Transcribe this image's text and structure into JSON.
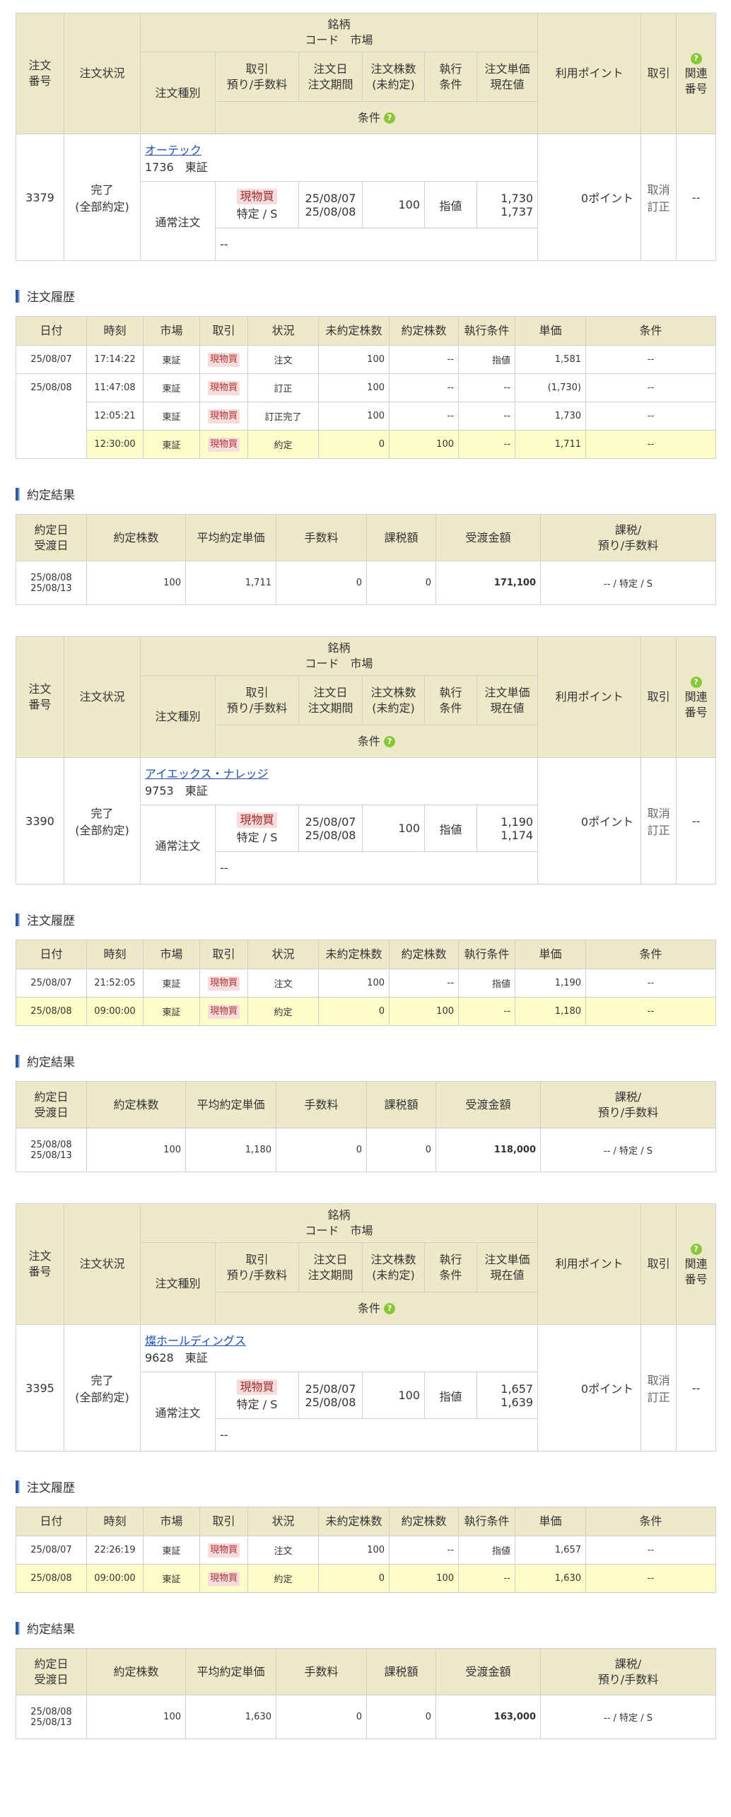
{
  "order_header": {
    "meigara": "銘柄",
    "code_market": "コード　市場",
    "order_no": "注文\n番号",
    "status": "注文状況",
    "order_type": "注文種別",
    "torihiki": "取引\n預り/手数料",
    "order_date": "注文日\n注文期間",
    "qty": "注文株数\n(未約定)",
    "exec_cond": "執行\n条件",
    "price": "注文単価\n現在値",
    "points": "利用ポイント",
    "trade": "取引",
    "related": "関連\n番号",
    "conditions": "条件"
  },
  "section_labels": {
    "history": "注文履歴",
    "result": "約定結果"
  },
  "history_header": [
    "日付",
    "時刻",
    "市場",
    "取引",
    "状況",
    "未約定株数",
    "約定株数",
    "執行条件",
    "単価",
    "条件"
  ],
  "result_header": [
    "約定日\n受渡日",
    "約定株数",
    "平均約定単価",
    "手数料",
    "課税額",
    "受渡金額",
    "課税/\n預り/手数料"
  ],
  "orders": [
    {
      "no": "3379",
      "status": "完了\n(全部約定)",
      "name": "オーテック",
      "code_market": "1736　東証",
      "order_type": "通常注文",
      "badge": "現物買",
      "account": "特定 / S",
      "date": "25/08/07\n25/08/08",
      "qty": "100",
      "exec": "指値",
      "price": "1,730\n1,737",
      "points": "0ポイント",
      "actions": "取消\n訂正",
      "related": "--",
      "condition": "--",
      "history": [
        {
          "date": "25/08/07",
          "time": "17:14:22",
          "market": "東証",
          "trade": "現物買",
          "status": "注文",
          "unfilled": "100",
          "filled": "--",
          "exec": "指値",
          "price": "1,581",
          "cond": "--",
          "hl": false
        },
        {
          "date": "25/08/08",
          "time": "11:47:08",
          "market": "東証",
          "trade": "現物買",
          "status": "訂正",
          "unfilled": "100",
          "filled": "--",
          "exec": "--",
          "price": "(1,730)",
          "cond": "--",
          "hl": false
        },
        {
          "date": "",
          "time": "12:05:21",
          "market": "東証",
          "trade": "現物買",
          "status": "訂正完了",
          "unfilled": "100",
          "filled": "--",
          "exec": "--",
          "price": "1,730",
          "cond": "--",
          "hl": false
        },
        {
          "date": "",
          "time": "12:30:00",
          "market": "東証",
          "trade": "現物買",
          "status": "約定",
          "unfilled": "0",
          "filled": "100",
          "exec": "--",
          "price": "1,711",
          "cond": "--",
          "hl": true
        }
      ],
      "result": {
        "dates": "25/08/08\n25/08/13",
        "qty": "100",
        "avg": "1,711",
        "fee": "0",
        "tax": "0",
        "amount": "171,100",
        "acct": "-- / 特定 / S"
      }
    },
    {
      "no": "3390",
      "status": "完了\n(全部約定)",
      "name": "アイエックス・ナレッジ",
      "code_market": "9753　東証",
      "order_type": "通常注文",
      "badge": "現物買",
      "account": "特定 / S",
      "date": "25/08/07\n25/08/08",
      "qty": "100",
      "exec": "指値",
      "price": "1,190\n1,174",
      "points": "0ポイント",
      "actions": "取消\n訂正",
      "related": "--",
      "condition": "--",
      "history": [
        {
          "date": "25/08/07",
          "time": "21:52:05",
          "market": "東証",
          "trade": "現物買",
          "status": "注文",
          "unfilled": "100",
          "filled": "--",
          "exec": "指値",
          "price": "1,190",
          "cond": "--",
          "hl": false
        },
        {
          "date": "25/08/08",
          "time": "09:00:00",
          "market": "東証",
          "trade": "現物買",
          "status": "約定",
          "unfilled": "0",
          "filled": "100",
          "exec": "--",
          "price": "1,180",
          "cond": "--",
          "hl": true
        }
      ],
      "result": {
        "dates": "25/08/08\n25/08/13",
        "qty": "100",
        "avg": "1,180",
        "fee": "0",
        "tax": "0",
        "amount": "118,000",
        "acct": "-- / 特定 / S"
      }
    },
    {
      "no": "3395",
      "status": "完了\n(全部約定)",
      "name": "燦ホールディングス",
      "code_market": "9628　東証",
      "order_type": "通常注文",
      "badge": "現物買",
      "account": "特定 / S",
      "date": "25/08/07\n25/08/08",
      "qty": "100",
      "exec": "指値",
      "price": "1,657\n1,639",
      "points": "0ポイント",
      "actions": "取消\n訂正",
      "related": "--",
      "condition": "--",
      "history": [
        {
          "date": "25/08/07",
          "time": "22:26:19",
          "market": "東証",
          "trade": "現物買",
          "status": "注文",
          "unfilled": "100",
          "filled": "--",
          "exec": "指値",
          "price": "1,657",
          "cond": "--",
          "hl": false
        },
        {
          "date": "25/08/08",
          "time": "09:00:00",
          "market": "東証",
          "trade": "現物買",
          "status": "約定",
          "unfilled": "0",
          "filled": "100",
          "exec": "--",
          "price": "1,630",
          "cond": "--",
          "hl": true
        }
      ],
      "result": {
        "dates": "25/08/08\n25/08/13",
        "qty": "100",
        "avg": "1,630",
        "fee": "0",
        "tax": "0",
        "amount": "163,000",
        "acct": "-- / 特定 / S"
      }
    }
  ]
}
